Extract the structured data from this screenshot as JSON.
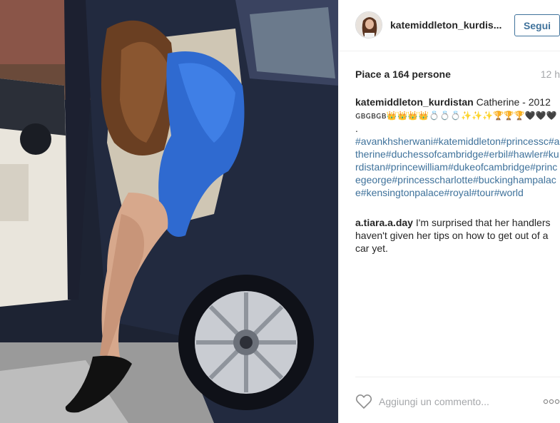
{
  "post": {
    "username": "katemiddleton_kurdistan",
    "username_truncated": "katemiddleton_kurdis...",
    "follow_label": "Segui",
    "likes": "Piace a 164 persone",
    "time": "12 h"
  },
  "caption": {
    "username": "katemiddleton_kurdistan",
    "text": "Catherine - 2012",
    "emoji_line": "ɢʙɢʙɢʙ👑👑👑👑💍💍💍✨✨✨🏆🏆🏆🖤🖤🖤",
    "dot": ".",
    "hashtags": "#avankhsherwani#katemiddleton#princessc#atherine#duchessofcambridge#erbil#hawler#kurdistan#princewilliam#dukeofcambridge#princegeorge#princesscharlotte#buckinghampalace#kensingtonpalace#royal#tour#world"
  },
  "comment": {
    "username": "a.tiara.a.day",
    "text": "I'm surprised that her handlers haven't given her tips on how to get out of a car yet."
  },
  "footer": {
    "comment_placeholder": "Aggiungi un commento...",
    "like_icon": "heart-icon",
    "options_icon": "more-options-icon"
  },
  "colors": {
    "link": "#3f729b",
    "muted": "#a5a7aa",
    "text": "#262626",
    "border": "#efefef"
  }
}
